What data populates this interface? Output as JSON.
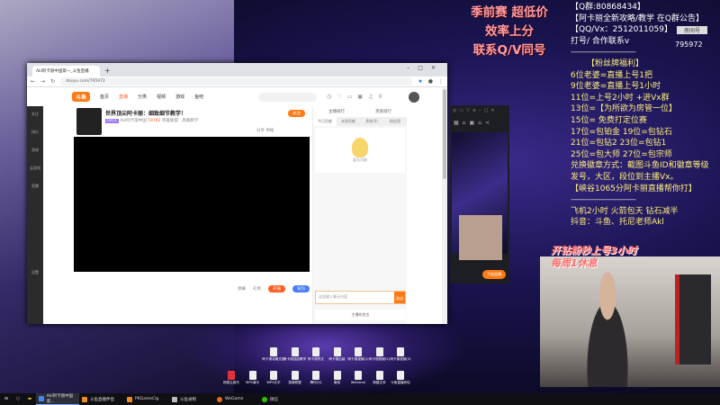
{
  "overlay": {
    "promo": [
      "季前赛  超低价",
      "效率上分",
      "联系Q/V同号"
    ],
    "info_lines": [
      "【Q群:80868434】",
      "【阿卡丽全新攻略/教学 在Q群公告】",
      "【QQ/Vx：2512011059】",
      "打号/ 合作联系v",
      "--------------------------------",
      "【粉丝牌福利】",
      "6位老婆=直播上号1把",
      "9位老婆=直播上号1小时",
      "11位=上号2小时  +进Vx群",
      "13位=【为所欲为房管一位】",
      "15位= 免费打定位赛",
      "17位=包铂金   19位=包钻石",
      "21位=包钻2    23位=包钻1",
      "25位=包大师   27位=包宗师",
      "兑换徽章方式：截图斗鱼ID和徽章等级",
      "发号，大区，段位到主播Vx。",
      "【峡谷1065分阿卡丽直播帮你打】",
      "--------------------------------",
      "飞机2小时  火箭包天  钻石减半",
      "抖音：斗鱼、托尼老师Akl"
    ],
    "room_label": "房间号",
    "room_id": "795972",
    "cam_caption": [
      "开钻粉秒上号3小时",
      "每周1休息"
    ]
  },
  "browser": {
    "tab_title": "Akl阿卡丽中国第一_斗鱼直播",
    "url": "douyu.com/795972",
    "logo": "斗鱼",
    "nav": [
      "首页",
      "直播",
      "分类",
      "视频",
      "游戏",
      "鱼吧"
    ],
    "header_icons": [
      "历史",
      "关注",
      "开播",
      "客户端",
      "消息",
      "创作中心"
    ],
    "sidebar": [
      "关注",
      "排行",
      "游戏",
      "云游戏",
      "直播",
      "设置"
    ],
    "stream": {
      "title": "世界顶尖阿卡丽：细致细节教学！",
      "anchor": "Akl阿卡丽中国",
      "level": "LV51",
      "hot": "59782",
      "tags": "英雄联盟 · 高端教学",
      "follow": "关注",
      "share": "分享",
      "report": "举报"
    },
    "controls": {
      "a": "弹幕",
      "b": "礼物",
      "btn1": "充值",
      "btn2": "背包"
    },
    "chat": {
      "top1": "主播排行",
      "top2": "贵族排行",
      "tabs": [
        "今日贡献",
        "本周贡献",
        "贵宾(0)",
        "粉丝团"
      ],
      "empty": "暂无贡献",
      "placeholder": "这里输入聊天内容",
      "send": "发送",
      "footer": "主播的发言"
    }
  },
  "phone": {
    "live_button": "开始直播"
  },
  "desktop_icons": [
    "阿卡丽攻略文档",
    "阿卡丽连招教学",
    "阿卡丽符文",
    "阿卡丽出装",
    "阿卡丽视频(1)",
    "阿卡丽视频(2)",
    "阿卡丽视频(3)",
    "网易云音乐",
    "WPS演示",
    "WPS文字",
    "英雄联盟",
    "腾讯QQ",
    "微信",
    "WeGame",
    "新建文本",
    "斗鱼直播伴侣"
  ],
  "taskbar": [
    "Akl阿卡丽中国第...",
    "斗鱼直播伴侣",
    "PKGameClg",
    "斗鱼录制",
    "WeGame",
    "微信"
  ]
}
